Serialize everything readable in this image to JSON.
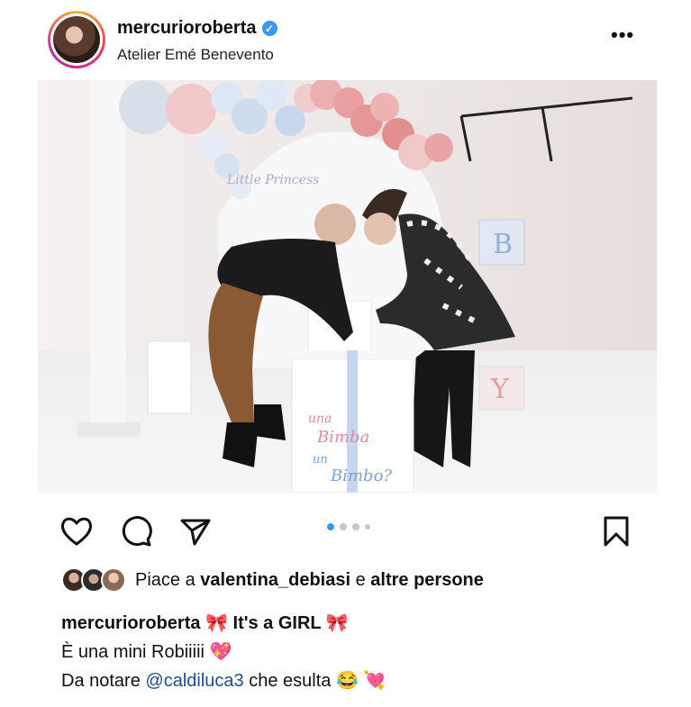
{
  "post": {
    "username": "mercurioroberta",
    "verified_mark": "✓",
    "location": "Atelier Emé Benevento",
    "more_icon": "more-options-icon",
    "more_label": "•••"
  },
  "photo": {
    "box_text_1": "una",
    "box_text_2": "Bimba",
    "box_text_3": "un",
    "box_text_4": "Bimbo?",
    "sign_text": "Little Princess",
    "block_b": "B",
    "block_y": "Y"
  },
  "actions": {
    "icons": [
      "heart-icon",
      "comment-icon",
      "share-icon",
      "bookmark-icon"
    ],
    "carousel_position": 1,
    "carousel_count": 4
  },
  "likes": {
    "prefix": "Piace a",
    "user": "valentina_debiasi",
    "conj": "e",
    "others": "altre persone"
  },
  "caption": {
    "username": "mercurioroberta",
    "line1_text": "🎀 It's a GIRL 🎀",
    "line2": "È una mini Robiiiii 💖",
    "line3_prefix": "Da notare",
    "mention": "@caldiluca3",
    "line3_suffix": "che esulta 😂 💘"
  },
  "colors": {
    "accent_blue": "#3897f0",
    "mention": "#1e4c8c"
  }
}
